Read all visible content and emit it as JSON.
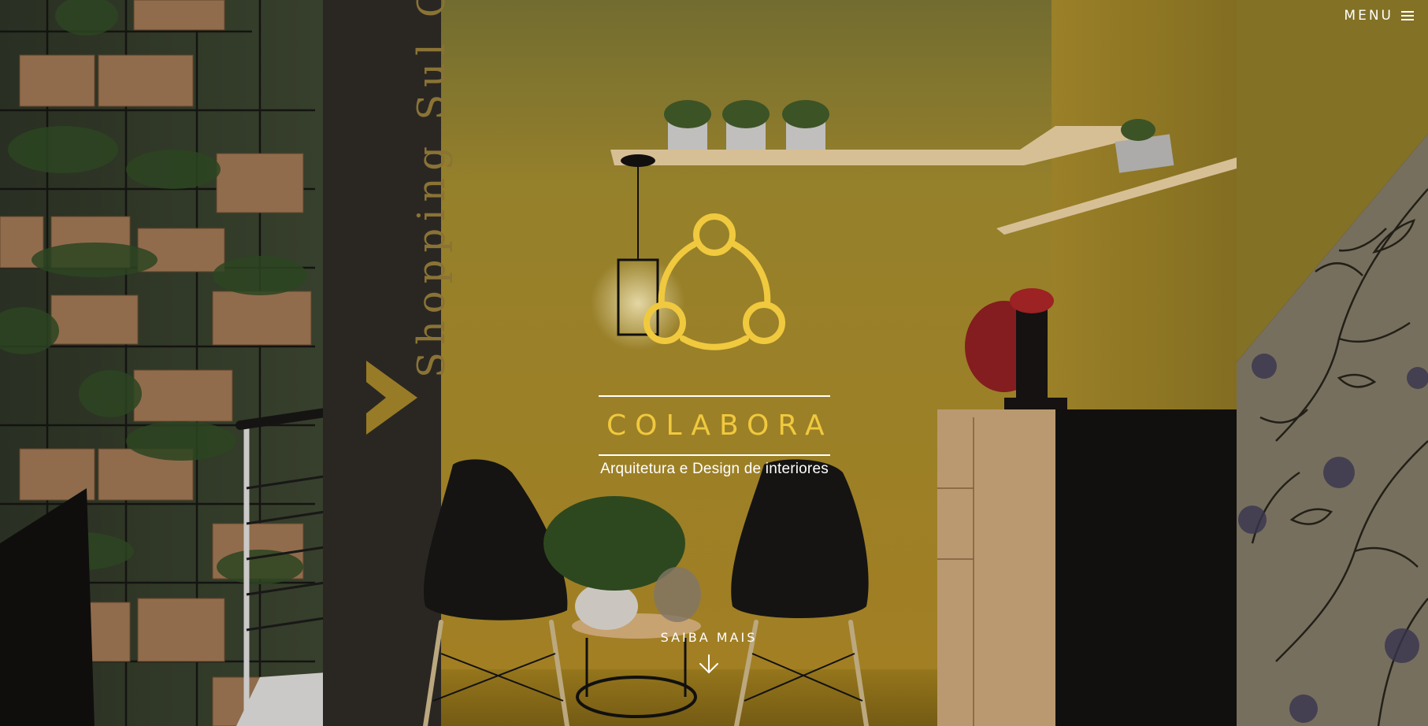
{
  "nav": {
    "menu_label": "MENU"
  },
  "hero": {
    "sign_text": "Shopping Sul Cow",
    "brand_name": "COLABORA",
    "tagline": "Arquitetura e Design de interiores",
    "cta_label": "SAIBA MAIS"
  },
  "icons": {
    "menu": "hamburger-icon",
    "logo": "colabora-logo",
    "cta_arrow": "arrow-down-icon"
  },
  "colors": {
    "brand_yellow": "#f0c93e",
    "wall_yellow": "#d7a935",
    "text_white": "#ffffff",
    "dark_panel": "#2a2722",
    "green_wall": "#3d4a33"
  }
}
